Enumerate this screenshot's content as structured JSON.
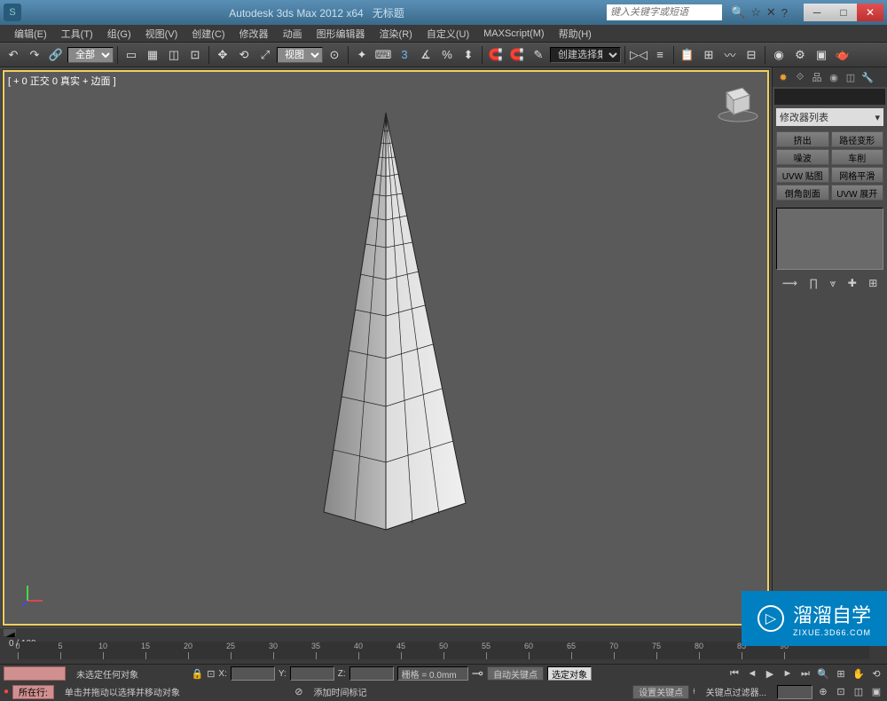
{
  "title": "Autodesk 3ds Max 2012 x64",
  "doc_title": "无标题",
  "search_placeholder": "键入关键字或短语",
  "menus": [
    "编辑(E)",
    "工具(T)",
    "组(G)",
    "视图(V)",
    "创建(C)",
    "修改器",
    "动画",
    "图形编辑器",
    "渲染(R)",
    "自定义(U)",
    "MAXScript(M)",
    "帮助(H)"
  ],
  "toolbar": {
    "select_mode": "全部",
    "view_label": "视图",
    "selection_set": "创建选择集"
  },
  "viewport": {
    "label": "[ + 0 正交 0 真实 + 边面 ]"
  },
  "right_panel": {
    "modifier_list": "修改器列表",
    "mod_buttons": [
      "挤出",
      "路径变形",
      "噪波",
      "车削",
      "UVW 贴图",
      "网格平滑",
      "倒角剖面",
      "UVW 展开"
    ]
  },
  "timeline": {
    "frame_display": "0 / 100",
    "ticks": [
      0,
      5,
      10,
      15,
      20,
      25,
      30,
      35,
      40,
      45,
      50,
      55,
      60,
      65,
      70,
      75,
      80,
      85,
      90
    ]
  },
  "status": {
    "selection": "未选定任何对象",
    "hint": "单击并拖动以选择并移动对象",
    "add_marker": "添加时间标记",
    "grid": "栅格 = 0.0mm",
    "auto_key": "自动关键点",
    "sel_obj": "选定对象",
    "set_key": "设置关键点",
    "filter": "关键点过滤器...",
    "location": "所在行:",
    "x_label": "X:",
    "y_label": "Y:",
    "z_label": "Z:"
  },
  "watermark": {
    "text": "溜溜自学",
    "url": "ZIXUE.3D66.COM"
  }
}
